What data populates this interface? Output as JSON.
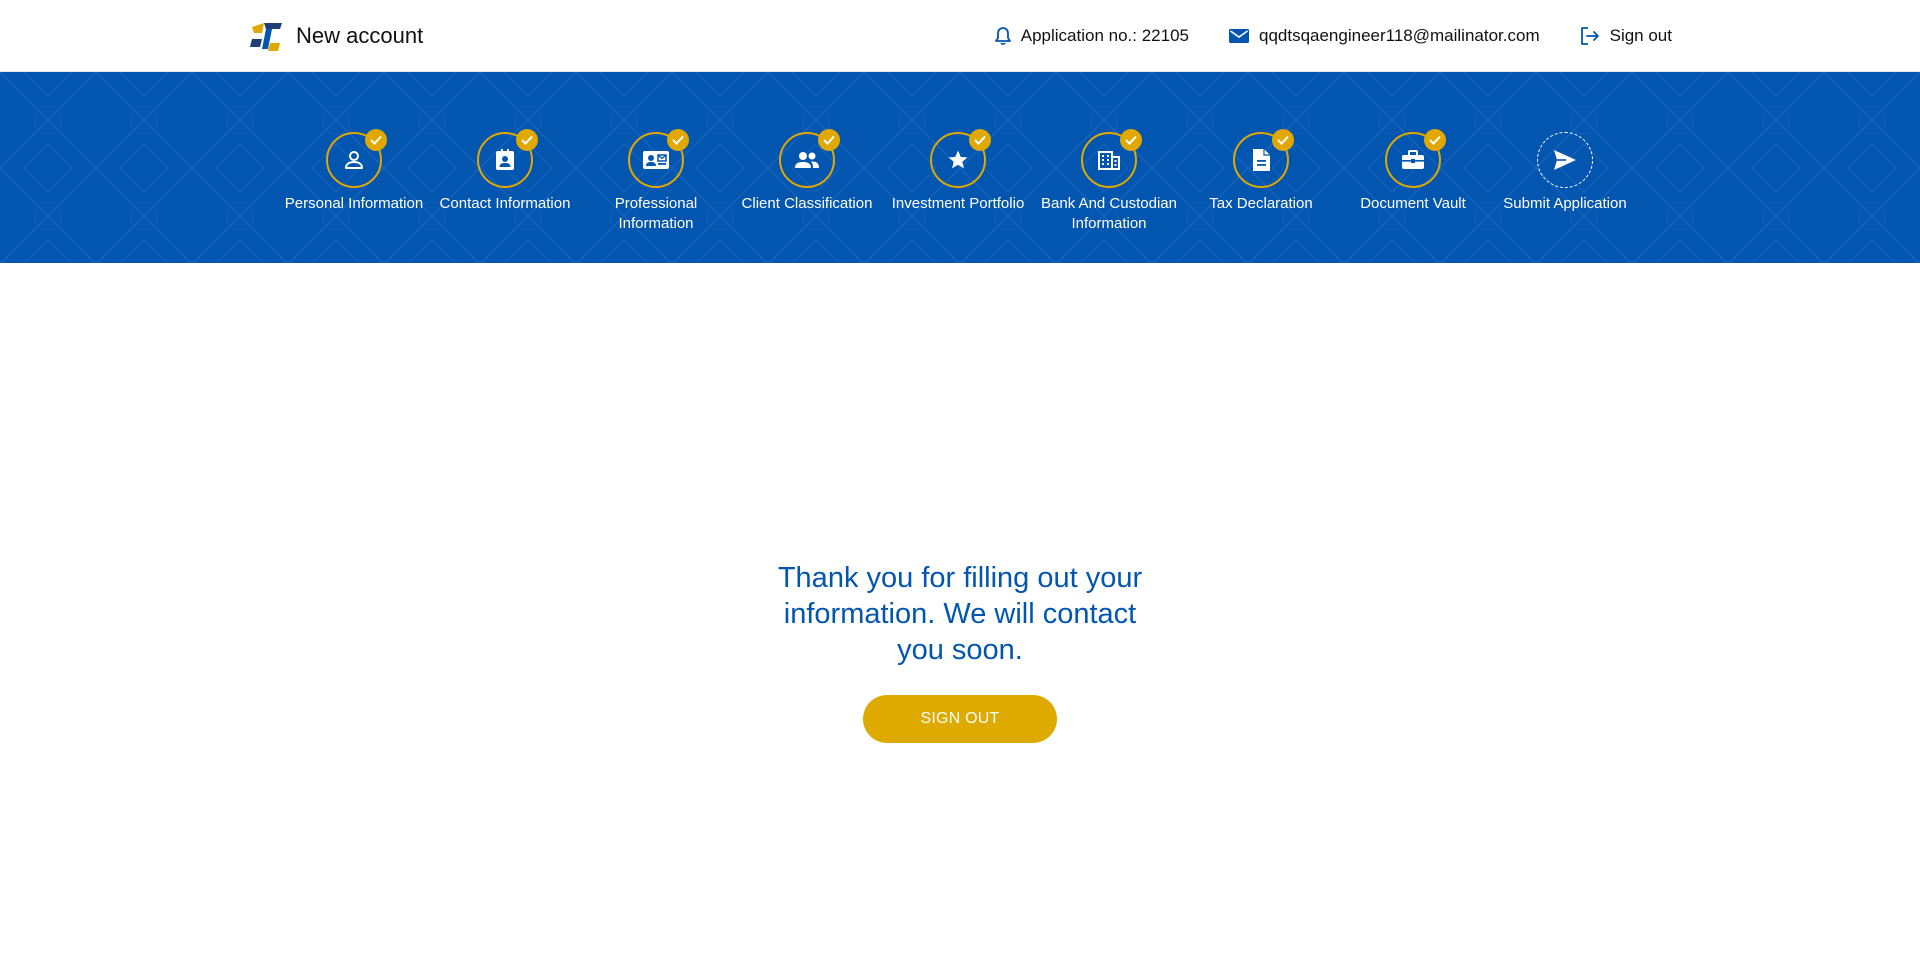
{
  "header": {
    "title": "New account",
    "application_label": "Application no.: 22105",
    "email": "qqdtsqaengineer118@mailinator.com",
    "signout_label": "Sign out"
  },
  "colors": {
    "primary_blue": "#0356b0",
    "accent_gold": "#e0a800"
  },
  "steps": [
    {
      "label": "Personal Information",
      "icon": "person-icon",
      "completed": true
    },
    {
      "label": "Contact Information",
      "icon": "contact-card-icon",
      "completed": true
    },
    {
      "label": "Professional Information",
      "icon": "id-card-icon",
      "completed": true
    },
    {
      "label": "Client Classification",
      "icon": "people-icon",
      "completed": true
    },
    {
      "label": "Investment Portfolio",
      "icon": "star-icon",
      "completed": true
    },
    {
      "label": "Bank And Custodian Information",
      "icon": "building-icon",
      "completed": true
    },
    {
      "label": "Tax Declaration",
      "icon": "document-icon",
      "completed": true
    },
    {
      "label": "Document Vault",
      "icon": "briefcase-icon",
      "completed": true
    },
    {
      "label": "Submit Application",
      "icon": "send-icon",
      "completed": false
    }
  ],
  "main": {
    "message": "Thank you for filling out your information. We will contact you soon.",
    "button_label": "SIGN OUT"
  }
}
